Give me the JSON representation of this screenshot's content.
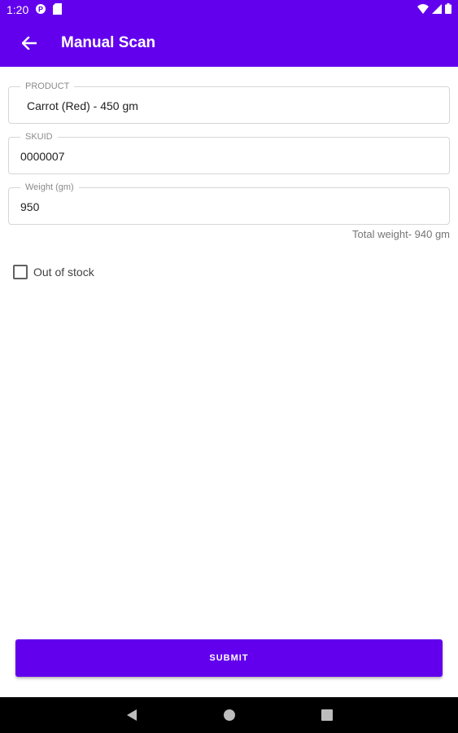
{
  "status_bar": {
    "time": "1:20",
    "icons": [
      "notification-p-icon",
      "sd-card-icon",
      "wifi-icon",
      "signal-icon",
      "battery-icon"
    ]
  },
  "app_bar": {
    "title": "Manual Scan",
    "back_icon": "arrow-back-icon"
  },
  "form": {
    "product": {
      "label": "PRODUCT",
      "value": "Carrot (Red) - 450 gm"
    },
    "skuid": {
      "label": "SKUID",
      "value": "0000007"
    },
    "weight": {
      "label": "Weight (gm)",
      "value": "950"
    },
    "total_weight": "Total weight- 940 gm",
    "out_of_stock": {
      "label": "Out of stock",
      "checked": false
    }
  },
  "submit_label": "SUBMIT",
  "nav_bar": {
    "icons": [
      "back-triangle-icon",
      "home-circle-icon",
      "recents-square-icon"
    ]
  },
  "colors": {
    "primary": "#6200EE",
    "nav_background": "#000000"
  }
}
